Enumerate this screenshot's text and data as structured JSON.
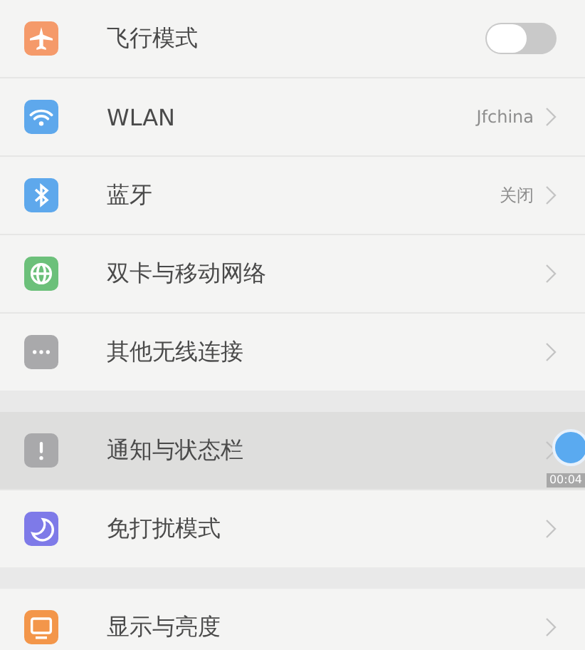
{
  "sections": [
    {
      "items": [
        {
          "kind": "toggle",
          "color": "#f59a6a",
          "label": "飞行模式",
          "on": false,
          "selected": false
        },
        {
          "kind": "link",
          "color": "#5ea8ec",
          "label": "WLAN",
          "value": "Jfchina",
          "selected": false
        },
        {
          "kind": "link",
          "color": "#5ea8ec",
          "label": "蓝牙",
          "value": "关闭",
          "selected": false
        },
        {
          "kind": "link",
          "color": "#6cc07a",
          "label": "双卡与移动网络",
          "selected": false
        },
        {
          "kind": "link",
          "color": "#a9a9ab",
          "label": "其他无线连接",
          "selected": false
        }
      ]
    },
    {
      "items": [
        {
          "kind": "link",
          "color": "#a9a9ab",
          "label": "通知与状态栏",
          "selected": true
        },
        {
          "kind": "link",
          "color": "#7e7ae8",
          "label": "免打扰模式",
          "selected": false
        }
      ]
    },
    {
      "items": [
        {
          "kind": "link",
          "color": "#f3964a",
          "label": "显示与亮度",
          "selected": false
        }
      ]
    }
  ],
  "recorder": {
    "time": "00:04"
  }
}
